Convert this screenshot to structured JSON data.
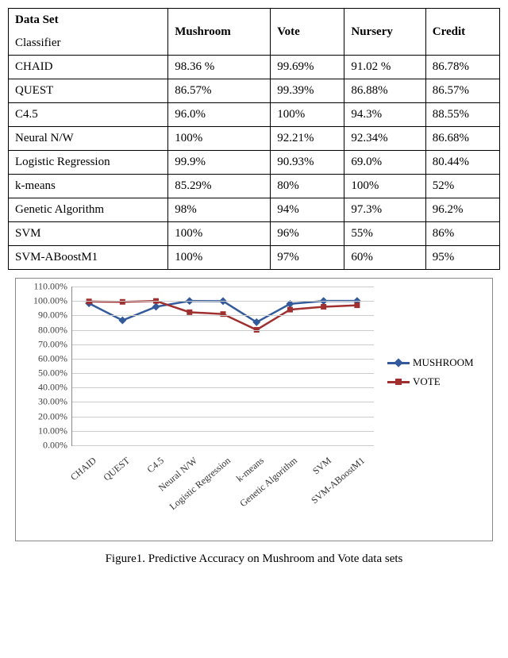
{
  "table": {
    "header_label": "Data Set",
    "sub_label": "Classifier",
    "columns": [
      "Mushroom",
      "Vote",
      "Nursery",
      "Credit"
    ],
    "rows": [
      {
        "name": "CHAID",
        "vals": [
          "98.36 %",
          "99.69%",
          "91.02 %",
          "86.78%"
        ]
      },
      {
        "name": "QUEST",
        "vals": [
          "86.57%",
          "99.39%",
          "86.88%",
          "86.57%"
        ]
      },
      {
        "name": "C4.5",
        "vals": [
          "96.0%",
          "100%",
          "94.3%",
          "88.55%"
        ]
      },
      {
        "name": "Neural N/W",
        "vals": [
          "100%",
          "92.21%",
          "92.34%",
          "86.68%"
        ]
      },
      {
        "name": "Logistic Regression",
        "vals": [
          "99.9%",
          "90.93%",
          "69.0%",
          "80.44%"
        ]
      },
      {
        "name": "k-means",
        "vals": [
          "85.29%",
          "80%",
          "100%",
          "52%"
        ]
      },
      {
        "name": "Genetic Algorithm",
        "vals": [
          "98%",
          "94%",
          "97.3%",
          "96.2%"
        ]
      },
      {
        "name": "SVM",
        "vals": [
          "100%",
          "96%",
          "55%",
          "86%"
        ]
      },
      {
        "name": "SVM-ABoostM1",
        "vals": [
          "100%",
          "97%",
          "60%",
          "95%"
        ]
      }
    ]
  },
  "chart_data": {
    "type": "line",
    "title": "",
    "xlabel": "",
    "ylabel": "",
    "ylim": [
      0,
      110
    ],
    "yticks": [
      "0.00%",
      "10.00%",
      "20.00%",
      "30.00%",
      "40.00%",
      "50.00%",
      "60.00%",
      "70.00%",
      "80.00%",
      "90.00%",
      "100.00%",
      "110.00%"
    ],
    "categories": [
      "CHAID",
      "QUEST",
      "C4.5",
      "Neural N/W",
      "Logistic Regression",
      "k-means",
      "Genetic Algorithm",
      "SVM",
      "SVM-ABoostM1"
    ],
    "series": [
      {
        "name": "MUSHROOM",
        "color": "#335a9a",
        "marker": "diamond",
        "values": [
          98.36,
          86.57,
          96.0,
          100,
          99.9,
          85.29,
          98,
          100,
          100
        ]
      },
      {
        "name": "VOTE",
        "color": "#a03030",
        "marker": "square",
        "values": [
          99.69,
          99.39,
          100,
          92.21,
          90.93,
          80,
          94,
          96,
          97
        ]
      }
    ]
  },
  "caption": "Figure1. Predictive Accuracy on Mushroom and Vote data sets"
}
